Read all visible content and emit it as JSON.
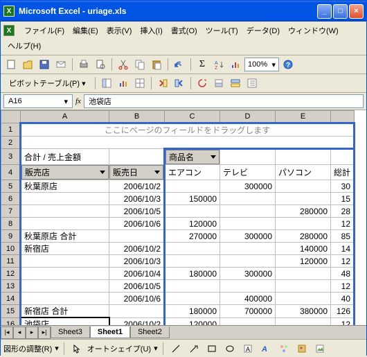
{
  "window": {
    "title": "Microsoft Excel - uriage.xls"
  },
  "menus": {
    "file": "ファイル(F)",
    "edit": "編集(E)",
    "view": "表示(V)",
    "insert": "挿入(I)",
    "format": "書式(O)",
    "tools": "ツール(T)",
    "data": "データ(D)",
    "window": "ウィンドウ(W)",
    "help": "ヘルプ(H)"
  },
  "zoom": "100%",
  "pivot": {
    "label": "ピボットテーブル(P)"
  },
  "namebox": "A16",
  "formula": "池袋店",
  "columns": [
    "A",
    "B",
    "C",
    "D",
    "E"
  ],
  "hint": "ここにページのフィールドをドラッグします",
  "headers": {
    "sumLabel": "合計 / 売上金額",
    "productName": "商品名",
    "store": "販売店",
    "saleDate": "販売日",
    "p1": "エアコン",
    "p2": "テレビ",
    "p3": "パソコン",
    "total": "総計"
  },
  "rows": [
    {
      "n": 5,
      "a": "秋葉原店",
      "b": "2006/10/2",
      "c": "",
      "d": "300000",
      "e": ""
    },
    {
      "n": 6,
      "a": "",
      "b": "2006/10/3",
      "c": "150000",
      "d": "",
      "e": ""
    },
    {
      "n": 7,
      "a": "",
      "b": "2006/10/5",
      "c": "",
      "d": "",
      "e": "280000"
    },
    {
      "n": 8,
      "a": "",
      "b": "2006/10/6",
      "c": "120000",
      "d": "",
      "e": ""
    },
    {
      "n": 9,
      "a": "秋葉原店 合計",
      "b": "",
      "c": "270000",
      "d": "300000",
      "e": "280000"
    },
    {
      "n": 10,
      "a": "新宿店",
      "b": "2006/10/2",
      "c": "",
      "d": "",
      "e": "140000"
    },
    {
      "n": 11,
      "a": "",
      "b": "2006/10/3",
      "c": "",
      "d": "",
      "e": "120000"
    },
    {
      "n": 12,
      "a": "",
      "b": "2006/10/4",
      "c": "180000",
      "d": "300000",
      "e": ""
    },
    {
      "n": 13,
      "a": "",
      "b": "2006/10/5",
      "c": "",
      "d": "",
      "e": ""
    },
    {
      "n": 14,
      "a": "",
      "b": "2006/10/6",
      "c": "",
      "d": "400000",
      "e": ""
    },
    {
      "n": 15,
      "a": "新宿店 合計",
      "b": "",
      "c": "180000",
      "d": "700000",
      "e": "380000"
    },
    {
      "n": 16,
      "a": "池袋店",
      "b": "2006/10/2",
      "c": "120000",
      "d": "",
      "e": ""
    }
  ],
  "totals": {
    "r5": "30",
    "r6": "15",
    "r7": "28",
    "r8": "12",
    "r9": "85",
    "r10": "14",
    "r11": "12",
    "r12": "48",
    "r13": "12",
    "r14": "40",
    "r15": "126",
    "r16": "12"
  },
  "tabs": {
    "t1": "Sheet3",
    "t2": "Sheet1",
    "t3": "Sheet2"
  },
  "draw": {
    "adjust": "図形の調整(R)",
    "autoshape": "オートシェイプ(U)"
  }
}
